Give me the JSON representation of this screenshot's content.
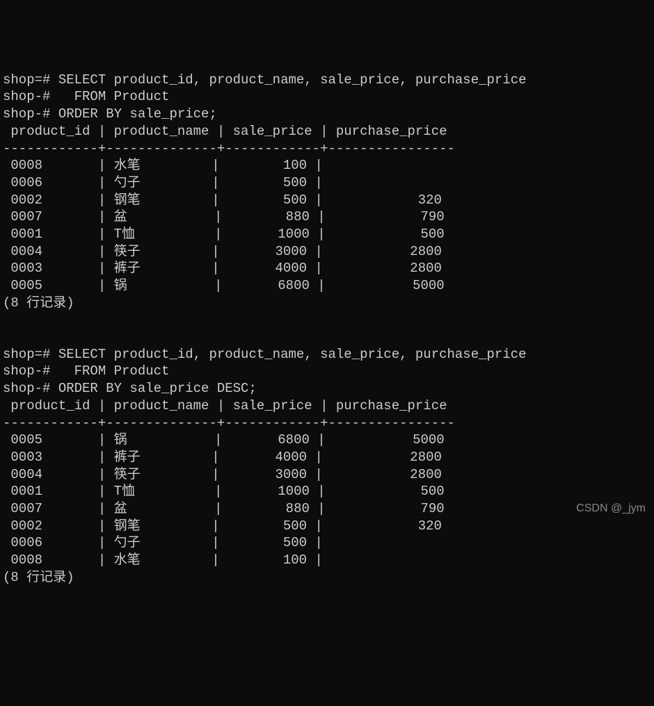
{
  "query1": {
    "prompt_lines": [
      "shop=# SELECT product_id, product_name, sale_price, purchase_price",
      "shop-#   FROM Product",
      "shop-# ORDER BY sale_price;"
    ],
    "header": " product_id | product_name | sale_price | purchase_price",
    "divider": "------------+--------------+------------+----------------",
    "rows": [
      {
        "product_id": "0008",
        "product_name": "水笔",
        "sale_price": "100",
        "purchase_price": ""
      },
      {
        "product_id": "0006",
        "product_name": "勺子",
        "sale_price": "500",
        "purchase_price": ""
      },
      {
        "product_id": "0002",
        "product_name": "钢笔",
        "sale_price": "500",
        "purchase_price": "320"
      },
      {
        "product_id": "0007",
        "product_name": "盆",
        "sale_price": "880",
        "purchase_price": "790"
      },
      {
        "product_id": "0001",
        "product_name": "T恤",
        "sale_price": "1000",
        "purchase_price": "500"
      },
      {
        "product_id": "0004",
        "product_name": "筷子",
        "sale_price": "3000",
        "purchase_price": "2800"
      },
      {
        "product_id": "0003",
        "product_name": "裤子",
        "sale_price": "4000",
        "purchase_price": "2800"
      },
      {
        "product_id": "0005",
        "product_name": "锅",
        "sale_price": "6800",
        "purchase_price": "5000"
      }
    ],
    "footer": "(8 行记录)"
  },
  "query2": {
    "prompt_lines": [
      "shop=# SELECT product_id, product_name, sale_price, purchase_price",
      "shop-#   FROM Product",
      "shop-# ORDER BY sale_price DESC;"
    ],
    "header": " product_id | product_name | sale_price | purchase_price",
    "divider": "------------+--------------+------------+----------------",
    "rows": [
      {
        "product_id": "0005",
        "product_name": "锅",
        "sale_price": "6800",
        "purchase_price": "5000"
      },
      {
        "product_id": "0003",
        "product_name": "裤子",
        "sale_price": "4000",
        "purchase_price": "2800"
      },
      {
        "product_id": "0004",
        "product_name": "筷子",
        "sale_price": "3000",
        "purchase_price": "2800"
      },
      {
        "product_id": "0001",
        "product_name": "T恤",
        "sale_price": "1000",
        "purchase_price": "500"
      },
      {
        "product_id": "0007",
        "product_name": "盆",
        "sale_price": "880",
        "purchase_price": "790"
      },
      {
        "product_id": "0002",
        "product_name": "钢笔",
        "sale_price": "500",
        "purchase_price": "320"
      },
      {
        "product_id": "0006",
        "product_name": "勺子",
        "sale_price": "500",
        "purchase_price": ""
      },
      {
        "product_id": "0008",
        "product_name": "水笔",
        "sale_price": "100",
        "purchase_price": ""
      }
    ],
    "footer": "(8 行记录)"
  },
  "watermark": "CSDN @_jym"
}
